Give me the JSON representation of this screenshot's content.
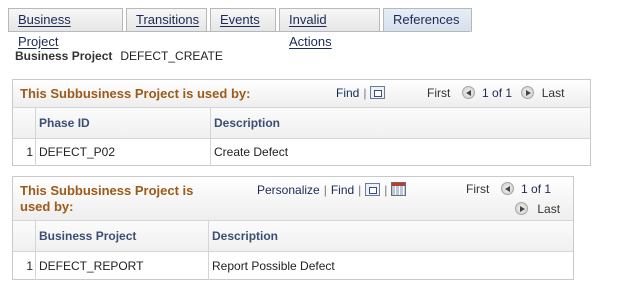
{
  "tabs": [
    {
      "label": "Business Project",
      "active": false
    },
    {
      "label": "Transitions",
      "active": false
    },
    {
      "label": "Events",
      "active": false
    },
    {
      "label": "Invalid Actions",
      "active": false
    },
    {
      "label": "References",
      "active": true
    }
  ],
  "business_project": {
    "label": "Business Project",
    "value": "DEFECT_CREATE"
  },
  "grid1": {
    "title": "This Subbusiness Project is used by:",
    "find": "Find",
    "first": "First",
    "count": "1 of 1",
    "last": "Last",
    "columns": [
      "Phase ID",
      "Description"
    ],
    "rows": [
      {
        "num": "1",
        "col1": "DEFECT_P02",
        "col2": "Create Defect"
      }
    ]
  },
  "grid2": {
    "title_line1": "This Subbusiness Project is",
    "title_line2": "used by:",
    "personalize": "Personalize",
    "find": "Find",
    "first": "First",
    "count": "1 of 1",
    "last": "Last",
    "columns": [
      "Business Project",
      "Description"
    ],
    "rows": [
      {
        "num": "1",
        "col1": "DEFECT_REPORT",
        "col2": "Report Possible Defect"
      }
    ]
  },
  "colors": {
    "title": "#9d5a19",
    "link": "#1b2a56",
    "header_text": "#3b4f72"
  }
}
